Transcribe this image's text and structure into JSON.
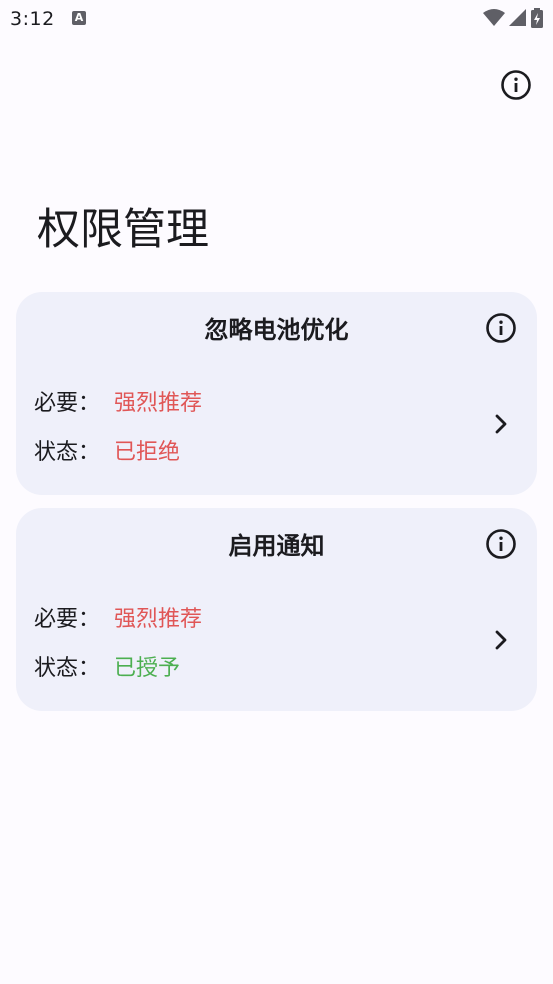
{
  "status_bar": {
    "time": "3:12",
    "notification_icon": "a-icon",
    "icons": [
      "wifi-icon",
      "signal-icon",
      "battery-charging-icon"
    ]
  },
  "header": {
    "info_icon": "info-icon"
  },
  "page": {
    "title": "权限管理"
  },
  "cards": [
    {
      "title": "忽略电池优化",
      "required_label": "必要：",
      "required_value": "强烈推荐",
      "status_label": "状态：",
      "status_value": "已拒绝",
      "status_color": "#e05656",
      "required_color": "#e05656"
    },
    {
      "title": "启用通知",
      "required_label": "必要：",
      "required_value": "强烈推荐",
      "status_label": "状态：",
      "status_value": "已授予",
      "status_color": "#4caf50",
      "required_color": "#e05656"
    }
  ],
  "colors": {
    "background": "#fdfbff",
    "card": "#eff0fa",
    "text": "#1b1b1f"
  }
}
